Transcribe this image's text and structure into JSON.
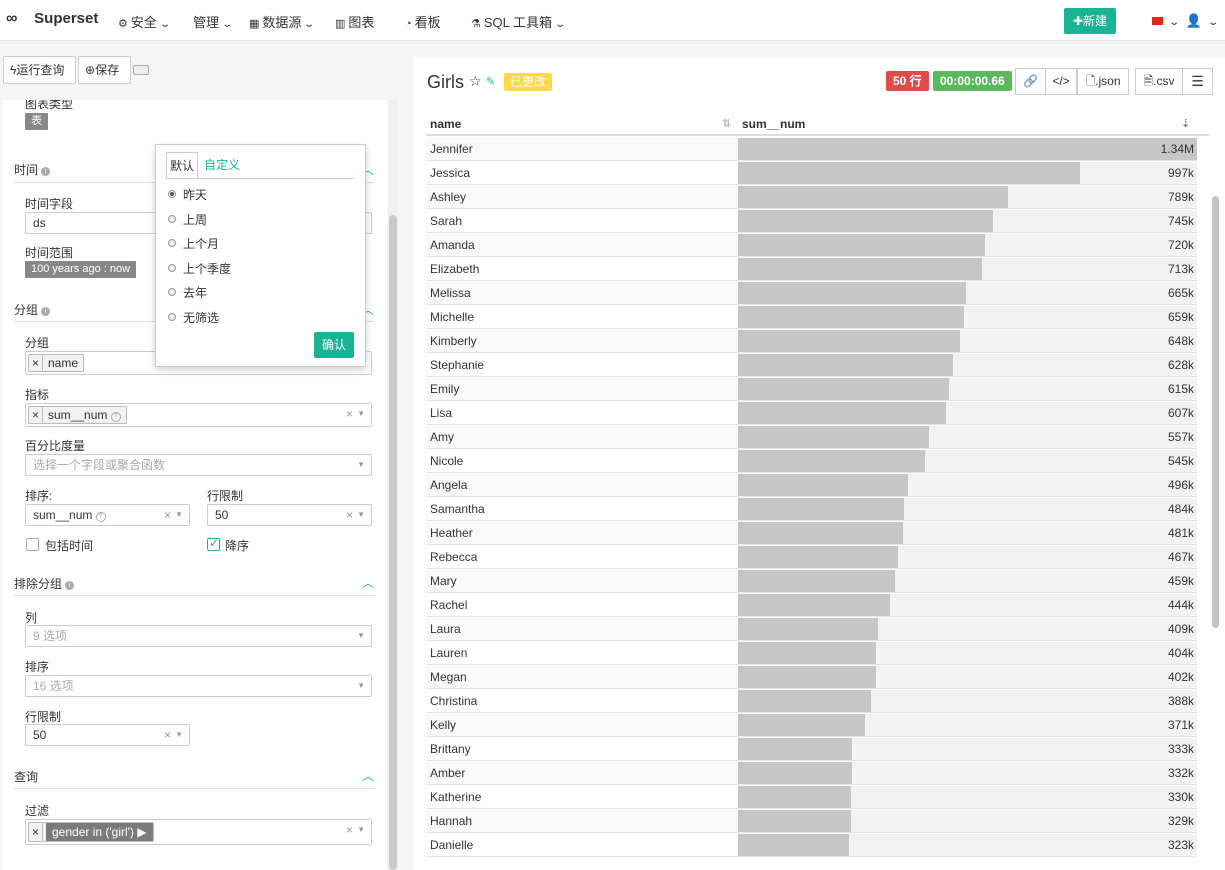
{
  "navbar": {
    "brand": "Superset",
    "items": [
      {
        "label": "安全",
        "icon": "cogs-icon",
        "caret": true
      },
      {
        "label": "管理",
        "icon": "",
        "caret": true
      },
      {
        "label": "数据源",
        "icon": "table-icon",
        "caret": true
      },
      {
        "label": "图表",
        "icon": "bar-chart-icon",
        "caret": false
      },
      {
        "label": "看板",
        "icon": "dashboard-icon",
        "caret": false
      },
      {
        "label": "SQL 工具箱",
        "icon": "flask-icon",
        "caret": true
      }
    ],
    "new_button": "新建"
  },
  "toolbar": {
    "run_query": "运行查询",
    "save": "保存"
  },
  "left": {
    "chart_type_label": "图表类型",
    "chart_type_value": "表",
    "time_section": "时间",
    "time_field_label": "时间字段",
    "time_field_value": "ds",
    "time_range_label": "时间范围",
    "time_range_value": "100 years ago : now",
    "group_section": "分组",
    "group_label": "分组",
    "group_tag": "name",
    "metrics_label": "指标",
    "metrics_tag": "sum__num",
    "percent_label": "百分比度量",
    "percent_placeholder": "选择一个字段或聚合函数",
    "order_label": "排序:",
    "order_value": "sum__num",
    "row_limit_label": "行限制",
    "row_limit_value": "50",
    "include_time_label": "包括时间",
    "descending_label": "降序",
    "not_grouped_section": "排除分组",
    "columns_label": "列",
    "columns_placeholder": "9 选项",
    "order2_label": "排序",
    "order2_placeholder": "16 选项",
    "row_limit2_label": "行限制",
    "row_limit2_value": "50",
    "query_section": "查询",
    "filter_label": "过滤",
    "filter_tag": "gender in ('girl')"
  },
  "popover": {
    "tab_default": "默认",
    "tab_custom": "自定义",
    "options": [
      "昨天",
      "上周",
      "上个月",
      "上个季度",
      "去年",
      "无筛选"
    ],
    "selected": 0,
    "ok": "确认"
  },
  "chart": {
    "title": "Girls",
    "changed": "已更改",
    "rowcount": "50 行",
    "timer": "00:00:00.66",
    "json_btn": ".json",
    "csv_btn": ".csv",
    "col_name": "name",
    "col_value": "sum__num"
  },
  "chart_data": {
    "type": "table",
    "columns": [
      "name",
      "sum__num"
    ],
    "max": 1340000,
    "rows": [
      {
        "name": "Jennifer",
        "value": 1340000,
        "label": "1.34M"
      },
      {
        "name": "Jessica",
        "value": 997000,
        "label": "997k"
      },
      {
        "name": "Ashley",
        "value": 789000,
        "label": "789k"
      },
      {
        "name": "Sarah",
        "value": 745000,
        "label": "745k"
      },
      {
        "name": "Amanda",
        "value": 720000,
        "label": "720k"
      },
      {
        "name": "Elizabeth",
        "value": 713000,
        "label": "713k"
      },
      {
        "name": "Melissa",
        "value": 665000,
        "label": "665k"
      },
      {
        "name": "Michelle",
        "value": 659000,
        "label": "659k"
      },
      {
        "name": "Kimberly",
        "value": 648000,
        "label": "648k"
      },
      {
        "name": "Stephanie",
        "value": 628000,
        "label": "628k"
      },
      {
        "name": "Emily",
        "value": 615000,
        "label": "615k"
      },
      {
        "name": "Lisa",
        "value": 607000,
        "label": "607k"
      },
      {
        "name": "Amy",
        "value": 557000,
        "label": "557k"
      },
      {
        "name": "Nicole",
        "value": 545000,
        "label": "545k"
      },
      {
        "name": "Angela",
        "value": 496000,
        "label": "496k"
      },
      {
        "name": "Samantha",
        "value": 484000,
        "label": "484k"
      },
      {
        "name": "Heather",
        "value": 481000,
        "label": "481k"
      },
      {
        "name": "Rebecca",
        "value": 467000,
        "label": "467k"
      },
      {
        "name": "Mary",
        "value": 459000,
        "label": "459k"
      },
      {
        "name": "Rachel",
        "value": 444000,
        "label": "444k"
      },
      {
        "name": "Laura",
        "value": 409000,
        "label": "409k"
      },
      {
        "name": "Lauren",
        "value": 404000,
        "label": "404k"
      },
      {
        "name": "Megan",
        "value": 402000,
        "label": "402k"
      },
      {
        "name": "Christina",
        "value": 388000,
        "label": "388k"
      },
      {
        "name": "Kelly",
        "value": 371000,
        "label": "371k"
      },
      {
        "name": "Brittany",
        "value": 333000,
        "label": "333k"
      },
      {
        "name": "Amber",
        "value": 332000,
        "label": "332k"
      },
      {
        "name": "Katherine",
        "value": 330000,
        "label": "330k"
      },
      {
        "name": "Hannah",
        "value": 329000,
        "label": "329k"
      },
      {
        "name": "Danielle",
        "value": 323000,
        "label": "323k"
      }
    ]
  }
}
